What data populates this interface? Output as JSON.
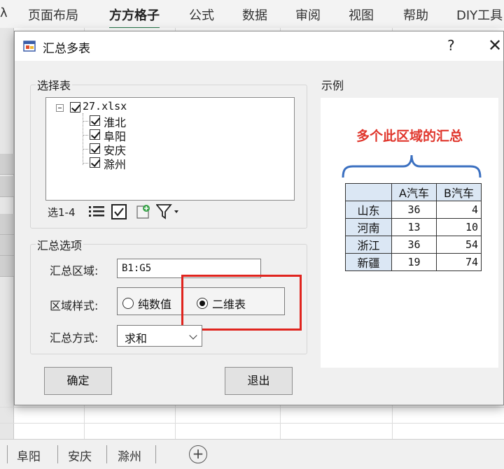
{
  "ribbon": {
    "partial_left": "λ",
    "tabs": [
      "页面布局",
      "方方格子",
      "公式",
      "数据",
      "审阅",
      "视图",
      "帮助",
      "DIY工具"
    ],
    "active": "方方格子"
  },
  "dialog": {
    "title": "汇总多表",
    "help": "?",
    "close": "✕",
    "select_group": {
      "label": "选择表",
      "root_file": "27.xlsx",
      "sheets": [
        "淮北",
        "阜阳",
        "安庆",
        "滁州"
      ],
      "toolbar_label": "选1-4"
    },
    "options_group": {
      "label": "汇总选项",
      "area_label": "汇总区域:",
      "area_value": "B1:G5",
      "style_label": "区域样式:",
      "style_options": [
        "纯数值",
        "二维表"
      ],
      "style_selected": "二维表",
      "method_label": "汇总方式:",
      "method_value": "求和"
    },
    "example_group": {
      "label": "示例",
      "heading": "多个此区域的汇总",
      "table": {
        "header": [
          "",
          "A汽车",
          "B汽车"
        ],
        "rows": [
          [
            "山东",
            "36",
            "4"
          ],
          [
            "河南",
            "13",
            "10"
          ],
          [
            "浙江",
            "36",
            "54"
          ],
          [
            "新疆",
            "19",
            "74"
          ]
        ]
      }
    },
    "ok_button": "确定",
    "exit_button": "退出"
  },
  "sheet_tabs": {
    "tabs": [
      "阜阳",
      "安庆",
      "滁州"
    ],
    "add": "+"
  },
  "colors": {
    "accent_green": "#217346",
    "highlight_red": "#e0241e",
    "example_title_red": "#e0362c",
    "brace_blue": "#3a6fc0",
    "table_header_blue": "#dbe7f4"
  }
}
